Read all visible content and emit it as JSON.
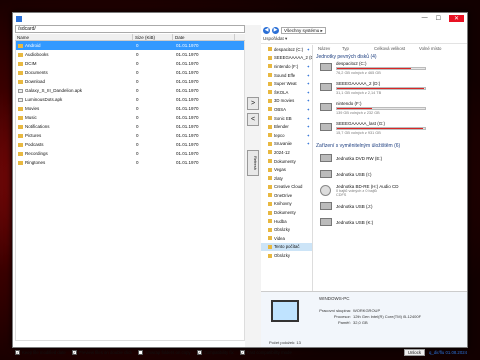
{
  "window": {
    "controls": {
      "min": "—",
      "max": "☐",
      "close": "✕"
    }
  },
  "left": {
    "path": "/sdcard/",
    "columns": [
      "Name",
      "Size (KiB)",
      "Date"
    ],
    "rows": [
      {
        "name": "Android",
        "size": "0",
        "date": "01.01.1970",
        "type": "folder",
        "selected": true
      },
      {
        "name": "Audiobooks",
        "size": "0",
        "date": "01.01.1970",
        "type": "folder"
      },
      {
        "name": "DCIM",
        "size": "0",
        "date": "01.01.1970",
        "type": "folder"
      },
      {
        "name": "Documents",
        "size": "0",
        "date": "01.01.1970",
        "type": "folder"
      },
      {
        "name": "Download",
        "size": "0",
        "date": "01.01.1970",
        "type": "folder"
      },
      {
        "name": "Galaxy_S_III_Dandelion.apk",
        "size": "0",
        "date": "01.01.1970",
        "type": "file"
      },
      {
        "name": "LuminousDots.apk",
        "size": "0",
        "date": "01.01.1970",
        "type": "file"
      },
      {
        "name": "Movies",
        "size": "0",
        "date": "01.01.1970",
        "type": "folder"
      },
      {
        "name": "Music",
        "size": "0",
        "date": "01.01.1970",
        "type": "folder"
      },
      {
        "name": "Notifications",
        "size": "0",
        "date": "01.01.1970",
        "type": "folder"
      },
      {
        "name": "Pictures",
        "size": "0",
        "date": "01.01.1970",
        "type": "folder"
      },
      {
        "name": "Podcasts",
        "size": "0",
        "date": "01.01.1970",
        "type": "folder"
      },
      {
        "name": "Recordings",
        "size": "0",
        "date": "01.01.1970",
        "type": "folder"
      },
      {
        "name": "Ringtones",
        "size": "0",
        "date": "01.01.1970",
        "type": "folder"
      }
    ]
  },
  "middle": {
    "push_label": ">",
    "pull_label": "<",
    "refresh_label": "Refresh"
  },
  "right": {
    "address": "Všechny systému  ▸",
    "toolbar": [
      "Uspořádat ▾"
    ],
    "columns": [
      "Název",
      "Typ",
      "Celková velikost",
      "Volné místo"
    ],
    "nav": [
      {
        "label": "despacito2 (C:)",
        "pin": true
      },
      {
        "label": "SEEEGAAAAA_2 (D:)",
        "pin": true
      },
      {
        "label": "nintendo (F:)",
        "pin": true
      },
      {
        "label": "Sound Effe",
        "pin": true
      },
      {
        "label": "Super Weat",
        "pin": true
      },
      {
        "label": "ŠKOLA",
        "pin": true
      },
      {
        "label": "3D movies",
        "pin": true
      },
      {
        "label": "OBSA",
        "pin": true
      },
      {
        "label": "Sonic EB",
        "pin": true
      },
      {
        "label": "Blender",
        "pin": true
      },
      {
        "label": "tepco",
        "pin": true
      },
      {
        "label": "Sruvaniie",
        "pin": true
      },
      {
        "label": "2024-12",
        "pin": false
      },
      {
        "label": "Dokumenty",
        "pin": false
      },
      {
        "label": "Vegas",
        "pin": false
      },
      {
        "label": "zlaty",
        "pin": false
      },
      {
        "label": "Creative Cloud",
        "pin": false
      },
      {
        "label": "OneDrive",
        "pin": false
      },
      {
        "label": "Knihovny",
        "pin": false
      },
      {
        "label": "Dokumenty",
        "pin": false
      },
      {
        "label": "Hudba",
        "pin": false
      },
      {
        "label": "Obrázky",
        "pin": false
      },
      {
        "label": "Videa",
        "pin": false
      },
      {
        "label": "Tento počítač",
        "pin": false,
        "selected": true
      },
      {
        "label": "Obrázky",
        "pin": false
      }
    ],
    "group_drives": "Jednotky pevných disků (4)",
    "drives": [
      {
        "name": "despacito2 (C:)",
        "free": "76,2 GB volných z 465 GB",
        "fill": 0.84
      },
      {
        "name": "SEEEGAAAAA_2 (D:)",
        "free": "31,1 GB volných z 2,14 TB",
        "fill": 0.99
      },
      {
        "name": "nintendo (F:)",
        "free": "139 GB volných z 232 GB",
        "fill": 0.4
      },
      {
        "name": "SEEEGAAAAA_last (G:)",
        "free": "15,7 GB volných z 931 GB",
        "fill": 0.98
      }
    ],
    "group_devices": "Zařízení s vyměnitelným úložištěm (6)",
    "devices": [
      {
        "name": "Jednotka DVD RW (E:)",
        "kind": "drive"
      },
      {
        "name": "Jednotka USB (I:)",
        "kind": "drive"
      },
      {
        "name": "Jednotka BD-RE (H:) Audio CD",
        "sub": "0 bajtů volných z 0 bajtů",
        "sub2": "CDFS",
        "kind": "cd"
      },
      {
        "name": "Jednotka USB (J:)",
        "kind": "drive"
      },
      {
        "name": "Jednotka USB (K:)",
        "kind": "drive"
      }
    ],
    "details": {
      "pc_name": "WINDOWS-PC",
      "workgroup_label": "Pracovní skupina:",
      "workgroup": "WORKGROUP",
      "processor_label": "Procesor:",
      "processor": "12th Gen Intel(R) Core(TM) i5-12400F",
      "memory_label": "Paměť:",
      "memory": "32,0 GB"
    },
    "status": "Počet položek: 13"
  },
  "bottom": {
    "checks": [
      {
        "label": "Keep file modified date",
        "checked": true
      },
      {
        "label": "Preview files on double click",
        "checked": true
      },
      {
        "label": "Unwrap folders on copy",
        "checked": false
      },
      {
        "label": "Compatibility fix",
        "checked": true
      },
      {
        "label": "Fast compatibility mode",
        "checked": true
      }
    ],
    "unlock_label": "Unlock",
    "version": "q_dir/flu 01.08.2024",
    "overflow": "»"
  }
}
